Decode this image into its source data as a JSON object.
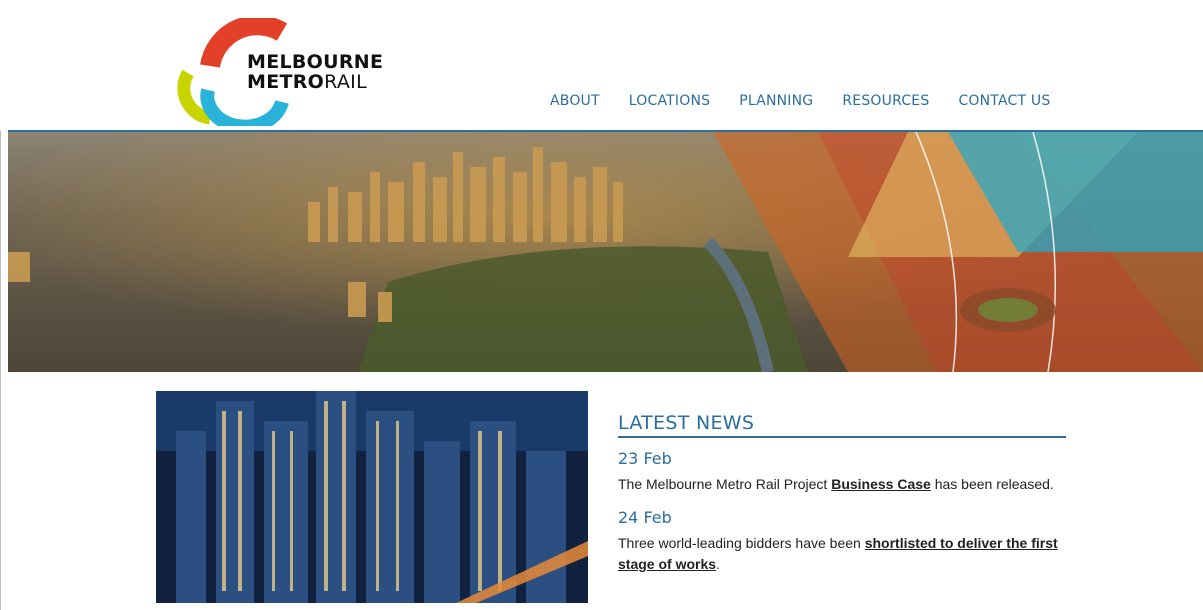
{
  "logo": {
    "line1": "MELBOURNE",
    "line2_bold": "METRO",
    "line2_light": "RAIL"
  },
  "nav": [
    {
      "label": "ABOUT"
    },
    {
      "label": "LOCATIONS"
    },
    {
      "label": "PLANNING"
    },
    {
      "label": "RESOURCES"
    },
    {
      "label": "CONTACT US"
    }
  ],
  "news": {
    "title": "LATEST NEWS",
    "items": [
      {
        "date": "23 Feb",
        "text_before": "The Melbourne Metro Rail Project ",
        "link": "Business Case",
        "text_after": " has been released."
      },
      {
        "date": "24 Feb",
        "text_before": "Three world-leading bidders have been ",
        "link": "shortlisted to deliver the first stage of works",
        "text_after": "."
      }
    ]
  },
  "colors": {
    "nav_blue": "#2a6ea0",
    "rule_blue": "#2f6f96",
    "logo_red": "#e3402a",
    "logo_yellow": "#c8d400",
    "logo_cyan": "#2ab3d8"
  }
}
